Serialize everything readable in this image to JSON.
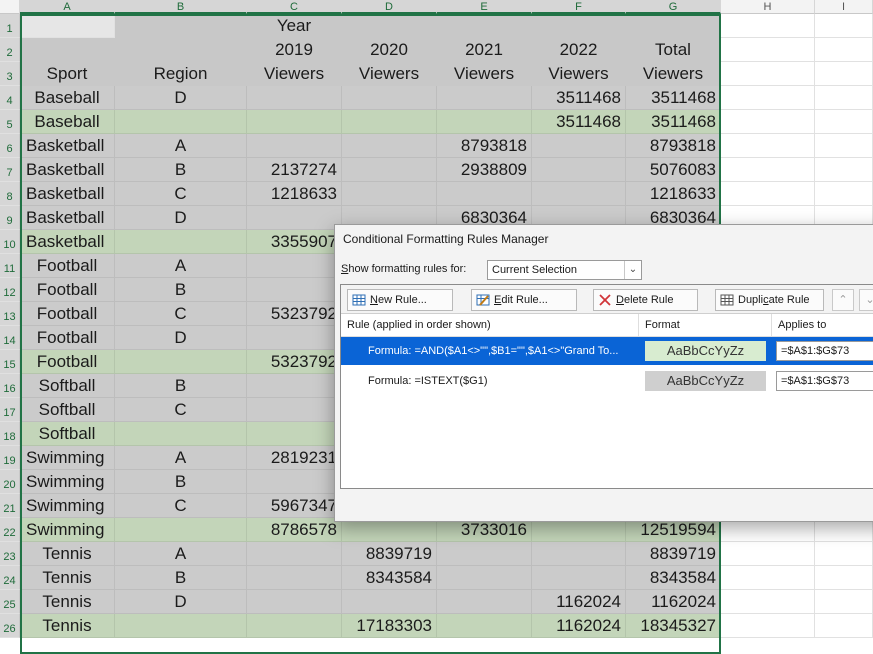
{
  "columns": [
    "A",
    "B",
    "C",
    "D",
    "E",
    "F",
    "G",
    "H",
    "I"
  ],
  "rows": [
    {
      "n": "1",
      "kind": "hdr",
      "cells": [
        "",
        "",
        "Year",
        "",
        "",
        "",
        ""
      ]
    },
    {
      "n": "2",
      "kind": "hdr",
      "cells": [
        "",
        "",
        "2019",
        "2020",
        "2021",
        "2022",
        "Total"
      ]
    },
    {
      "n": "3",
      "kind": "hdr",
      "cells": [
        "Sport",
        "Region",
        "Viewers",
        "Viewers",
        "Viewers",
        "Viewers",
        "Viewers"
      ]
    },
    {
      "n": "4",
      "kind": "sg",
      "cells": [
        "Baseball",
        "D",
        "",
        "",
        "",
        "3511468",
        "3511468"
      ]
    },
    {
      "n": "5",
      "kind": "gr",
      "cells": [
        "Baseball",
        "",
        "",
        "",
        "",
        "3511468",
        "3511468"
      ]
    },
    {
      "n": "6",
      "kind": "sg",
      "cells": [
        "Basketball",
        "A",
        "",
        "",
        "8793818",
        "",
        "8793818"
      ]
    },
    {
      "n": "7",
      "kind": "sg",
      "cells": [
        "Basketball",
        "B",
        "2137274",
        "",
        "2938809",
        "",
        "5076083"
      ]
    },
    {
      "n": "8",
      "kind": "sg",
      "cells": [
        "Basketball",
        "C",
        "1218633",
        "",
        "",
        "",
        "1218633"
      ]
    },
    {
      "n": "9",
      "kind": "sg",
      "cells": [
        "Basketball",
        "D",
        "",
        "",
        "6830364",
        "",
        "6830364"
      ]
    },
    {
      "n": "10",
      "kind": "gr",
      "cells": [
        "Basketball",
        "",
        "3355907",
        "",
        "",
        "",
        ""
      ]
    },
    {
      "n": "11",
      "kind": "sg",
      "cells": [
        "Football",
        "A",
        "",
        "",
        "",
        "",
        ""
      ]
    },
    {
      "n": "12",
      "kind": "sg",
      "cells": [
        "Football",
        "B",
        "",
        "",
        "",
        "",
        ""
      ]
    },
    {
      "n": "13",
      "kind": "sg",
      "cells": [
        "Football",
        "C",
        "5323792",
        "",
        "",
        "",
        ""
      ]
    },
    {
      "n": "14",
      "kind": "sg",
      "cells": [
        "Football",
        "D",
        "",
        "",
        "",
        "",
        ""
      ]
    },
    {
      "n": "15",
      "kind": "gr",
      "cells": [
        "Football",
        "",
        "5323792",
        "",
        "",
        "",
        ""
      ]
    },
    {
      "n": "16",
      "kind": "sg",
      "cells": [
        "Softball",
        "B",
        "",
        "",
        "",
        "",
        ""
      ]
    },
    {
      "n": "17",
      "kind": "sg",
      "cells": [
        "Softball",
        "C",
        "",
        "",
        "",
        "",
        ""
      ]
    },
    {
      "n": "18",
      "kind": "gr",
      "cells": [
        "Softball",
        "",
        "",
        "",
        "",
        "",
        ""
      ]
    },
    {
      "n": "19",
      "kind": "sg",
      "cells": [
        "Swimming",
        "A",
        "2819231",
        "",
        "",
        "",
        ""
      ]
    },
    {
      "n": "20",
      "kind": "sg",
      "cells": [
        "Swimming",
        "B",
        "",
        "",
        "",
        "",
        ""
      ]
    },
    {
      "n": "21",
      "kind": "sg",
      "cells": [
        "Swimming",
        "C",
        "5967347",
        "",
        "",
        "",
        ""
      ]
    },
    {
      "n": "22",
      "kind": "gr",
      "cells": [
        "Swimming",
        "",
        "8786578",
        "",
        "3733016",
        "",
        "12519594"
      ]
    },
    {
      "n": "23",
      "kind": "sg",
      "cells": [
        "Tennis",
        "A",
        "",
        "8839719",
        "",
        "",
        "8839719"
      ]
    },
    {
      "n": "24",
      "kind": "sg",
      "cells": [
        "Tennis",
        "B",
        "",
        "8343584",
        "",
        "",
        "8343584"
      ]
    },
    {
      "n": "25",
      "kind": "sg",
      "cells": [
        "Tennis",
        "D",
        "",
        "",
        "",
        "1162024",
        "1162024"
      ]
    },
    {
      "n": "26",
      "kind": "gr",
      "cells": [
        "Tennis",
        "",
        "",
        "17183303",
        "",
        "1162024",
        "18345327"
      ]
    }
  ],
  "dialog": {
    "title": "Conditional Formatting Rules Manager",
    "show_label_prefix": "S",
    "show_label_rest": "how formatting rules for:",
    "show_value": "Current Selection",
    "toolbar": {
      "new_u": "N",
      "new_rest": "ew Rule...",
      "edit_u": "E",
      "edit_rest": "dit Rule...",
      "delete_u": "D",
      "delete_rest": "elete Rule",
      "duplicate_a": "Dupli",
      "duplicate_u": "c",
      "duplicate_b": "ate Rule"
    },
    "columns": {
      "rule": "Rule (applied in order shown)",
      "format": "Format",
      "applies": "Applies to"
    },
    "rules": [
      {
        "text": "Formula: =AND($A1<>\"\",$B1=\"\",$A1<>\"Grand To...",
        "preview": "AaBbCcYyZz",
        "applies": "=$A$1:$G$73",
        "preview_bg": "#d8ecd0"
      },
      {
        "text": "Formula: =ISTEXT($G1)",
        "preview": "AaBbCcYyZz",
        "applies": "=$A$1:$G$73",
        "preview_bg": "#cfcfcf"
      }
    ]
  },
  "colors": {
    "selection_border": "#217346",
    "subtotal_green": "#c3d5b9",
    "data_gray": "#cbcbcb",
    "selected_rule": "#0a64d6"
  }
}
